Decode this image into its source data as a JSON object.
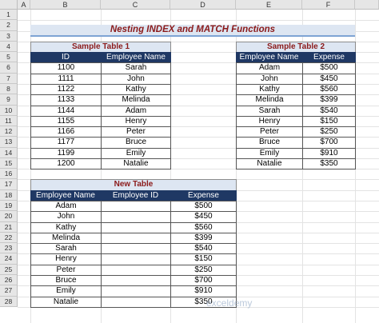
{
  "columns": [
    "A",
    "B",
    "C",
    "D",
    "E",
    "F"
  ],
  "rows": [
    "1",
    "2",
    "3",
    "4",
    "5",
    "6",
    "7",
    "8",
    "9",
    "10",
    "11",
    "12",
    "13",
    "14",
    "15",
    "16",
    "17",
    "18",
    "19",
    "20",
    "21",
    "22",
    "23",
    "24",
    "25",
    "26",
    "27",
    "28"
  ],
  "title": "Nesting INDEX and MATCH Functions",
  "table1": {
    "caption": "Sample Table 1",
    "headers": [
      "ID",
      "Employee Name"
    ],
    "rows": [
      [
        "1100",
        "Sarah"
      ],
      [
        "1111",
        "John"
      ],
      [
        "1122",
        "Kathy"
      ],
      [
        "1133",
        "Melinda"
      ],
      [
        "1144",
        "Adam"
      ],
      [
        "1155",
        "Henry"
      ],
      [
        "1166",
        "Peter"
      ],
      [
        "1177",
        "Bruce"
      ],
      [
        "1199",
        "Emily"
      ],
      [
        "1200",
        "Natalie"
      ]
    ]
  },
  "table2": {
    "caption": "Sample Table 2",
    "headers": [
      "Employee Name",
      "Expense"
    ],
    "rows": [
      [
        "Adam",
        "$500"
      ],
      [
        "John",
        "$450"
      ],
      [
        "Kathy",
        "$560"
      ],
      [
        "Melinda",
        "$399"
      ],
      [
        "Sarah",
        "$540"
      ],
      [
        "Henry",
        "$150"
      ],
      [
        "Peter",
        "$250"
      ],
      [
        "Bruce",
        "$700"
      ],
      [
        "Emily",
        "$910"
      ],
      [
        "Natalie",
        "$350"
      ]
    ]
  },
  "table3": {
    "caption": "New Table",
    "headers": [
      "Employee Name",
      "Employee ID",
      "Expense"
    ],
    "rows": [
      [
        "Adam",
        "",
        "$500"
      ],
      [
        "John",
        "",
        "$450"
      ],
      [
        "Kathy",
        "",
        "$560"
      ],
      [
        "Melinda",
        "",
        "$399"
      ],
      [
        "Sarah",
        "",
        "$540"
      ],
      [
        "Henry",
        "",
        "$150"
      ],
      [
        "Peter",
        "",
        "$250"
      ],
      [
        "Bruce",
        "",
        "$700"
      ],
      [
        "Emily",
        "",
        "$910"
      ],
      [
        "Natalie",
        "",
        "$350"
      ]
    ]
  },
  "watermark": "exceldemy"
}
